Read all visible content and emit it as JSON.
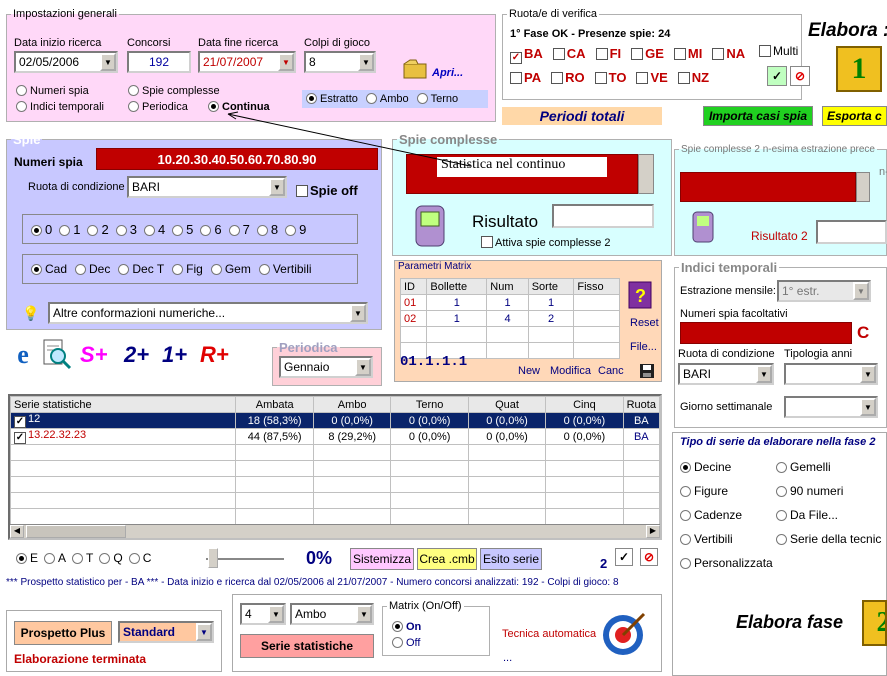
{
  "general": {
    "legend": "Impostazioni generali",
    "start_label": "Data inizio ricerca",
    "start_value": "02/05/2006",
    "concorsi_label": "Concorsi",
    "concorsi_value": "192",
    "end_label": "Data fine ricerca",
    "end_value": "21/07/2007",
    "colpi_label": "Colpi di gioco",
    "colpi_value": "8",
    "apri_label": "Apri...",
    "modes": [
      "Numeri spia",
      "Indici temporali",
      "Spie complesse",
      "Periodica",
      "Continua"
    ],
    "game_modes": [
      "Estratto",
      "Ambo",
      "Terno"
    ]
  },
  "ruote": {
    "legend": "Ruota/e di verifica",
    "status": "1° Fase OK - Presenze spie: 24",
    "row1": [
      "BA",
      "CA",
      "FI",
      "GE",
      "MI",
      "NA"
    ],
    "row2": [
      "PA",
      "RO",
      "TO",
      "VE",
      "NZ"
    ],
    "multi_label": "Multi",
    "checked": "BA"
  },
  "elabora": {
    "title": "Elabora :",
    "fase_title": "Elabora fase"
  },
  "buttons": {
    "periodi": "Periodi totali",
    "importa": "Importa casi spia",
    "esporta": "Esporta c",
    "sistemizza": "Sistemizza",
    "crea": "Crea .cmb",
    "esito": "Esito serie",
    "prospetto": "Prospetto Plus",
    "serie_stat": "Serie statistiche",
    "new": "New",
    "modifica": "Modifica",
    "canc": "Canc",
    "reset": "Reset",
    "file": "File..."
  },
  "spie": {
    "legend": "Spie",
    "numeri_label": "Numeri spia",
    "numeri_value": "10.20.30.40.50.60.70.80.90",
    "ruota_label": "Ruota di condizione",
    "ruota_value": "BARI",
    "spie_off": "Spie off",
    "digits": [
      "0",
      "1",
      "2",
      "3",
      "4",
      "5",
      "6",
      "7",
      "8",
      "9"
    ],
    "types": [
      "Cad",
      "Dec",
      "Dec T",
      "Fig",
      "Gem",
      "Vertibili"
    ],
    "altre": "Altre conformazioni numeriche..."
  },
  "symbols": {
    "s": "S+",
    "two": "2+",
    "one": "1+",
    "r": "R+"
  },
  "periodica": {
    "legend": "Periodica",
    "value": "Gennaio"
  },
  "complesse": {
    "legend": "Spie complesse",
    "text": "Statistica nel continuo",
    "risultato": "Risultato",
    "attiva": "Attiva spie complesse 2",
    "legend2": "Spie complesse 2 n-esima estrazione prece",
    "risultato2": "Risultato 2",
    "n_label": "n-"
  },
  "matrix": {
    "legend": "Parametri Matrix",
    "headers": [
      "ID",
      "Bollette",
      "Num",
      "Sorte",
      "Fisso"
    ],
    "rows": [
      [
        "01",
        "1",
        "1",
        "1",
        ""
      ],
      [
        "02",
        "1",
        "4",
        "2",
        ""
      ]
    ],
    "code": "01.1.1.1"
  },
  "indici": {
    "legend": "Indici temporali",
    "estrazione_label": "Estrazione mensile:",
    "estrazione_value": "1° estr.",
    "facoltativi": "Numeri spia facoltativi",
    "c_label": "C",
    "ruota_label": "Ruota di condizione",
    "ruota_value": "BARI",
    "tipologia": "Tipologia anni",
    "giorno": "Giorno settimanale"
  },
  "series": {
    "headers": [
      "Serie statistiche",
      "Ambata",
      "Ambo",
      "Terno",
      "Quat",
      "Cinq",
      "Ruota"
    ],
    "rows": [
      [
        "12",
        "18 (58,3%)",
        "0 (0,0%)",
        "0 (0,0%)",
        "0 (0,0%)",
        "0 (0,0%)",
        "BA"
      ],
      [
        "13.22.32.23",
        "44 (87,5%)",
        "8 (29,2%)",
        "0 (0,0%)",
        "0 (0,0%)",
        "0 (0,0%)",
        "BA"
      ]
    ]
  },
  "bottom": {
    "radios": [
      "E",
      "A",
      "T",
      "Q",
      "C"
    ],
    "percent": "0%",
    "num": "2",
    "summary": "*** Prospetto statistico per  - BA ***  - Data inizio e ricerca dal 02/05/2006 al 21/07/2007 - Numero concorsi analizzati: 192 - Colpi di gioco: 8",
    "standard": "Standard",
    "elab_done": "Elaborazione terminata",
    "combo_num": "4",
    "combo_sorte": "Ambo",
    "matrix_legend": "Matrix (On/Off)",
    "on": "On",
    "off": "Off",
    "tecnica": "Tecnica automatica",
    "dots": "..."
  },
  "fase2": {
    "legend": "Tipo di serie da elaborare nella fase 2",
    "options": [
      "Decine",
      "Gemelli",
      "Figure",
      "90 numeri",
      "Cadenze",
      "Da File...",
      "Vertibili",
      "Serie della tecnic",
      "Personalizzata"
    ]
  }
}
